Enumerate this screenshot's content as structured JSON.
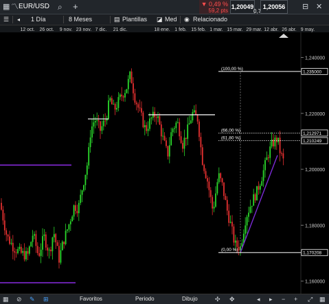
{
  "header": {
    "symbol": "EUR/USD",
    "change_pct": "▼ 0,49 %",
    "change_pts": "59,2 pts",
    "bid": "1,20049",
    "spread": "0,7",
    "ask": "1,20056"
  },
  "toolbar": {
    "interval": "1 Día",
    "range": "8 Meses",
    "templates": "Plantillas",
    "indicator": "Med",
    "related": "Relacionado"
  },
  "bottom": {
    "favorites": "Favoritos",
    "period": "Periodo",
    "drawing": "Dibujo"
  },
  "chart_data": {
    "type": "candlestick",
    "x_labels": [
      "12 oct.",
      "26 oct.",
      "9 nov.",
      "23 nov.",
      "7 dic.",
      "21 dic.",
      "18 ene.",
      "1 feb.",
      "15 feb.",
      "1 mar.",
      "15 mar.",
      "29 mar.",
      "12 abr.",
      "26 abr.",
      "9 may."
    ],
    "y_labels": [
      "1,240000",
      "1,220000",
      "1,200000",
      "1,180000",
      "1,160000"
    ],
    "ylim": [
      1.156,
      1.248
    ],
    "fib_levels": [
      {
        "label": "(100,00 %)",
        "value": "1,235000",
        "y": 1.235
      },
      {
        "label": "(66,00 %)",
        "value": "1,212971",
        "y": 1.212971
      },
      {
        "label": "(61,80 %)",
        "value": "1,210249",
        "y": 1.210249
      },
      {
        "label": "(0,00 %)",
        "value": "1,170208",
        "y": 1.170208
      }
    ],
    "close_price": 1.201,
    "colors": {
      "up": "#2bd92b",
      "down": "#e53030",
      "support": "#8a2be2",
      "trend": "#7b2bd6"
    }
  }
}
